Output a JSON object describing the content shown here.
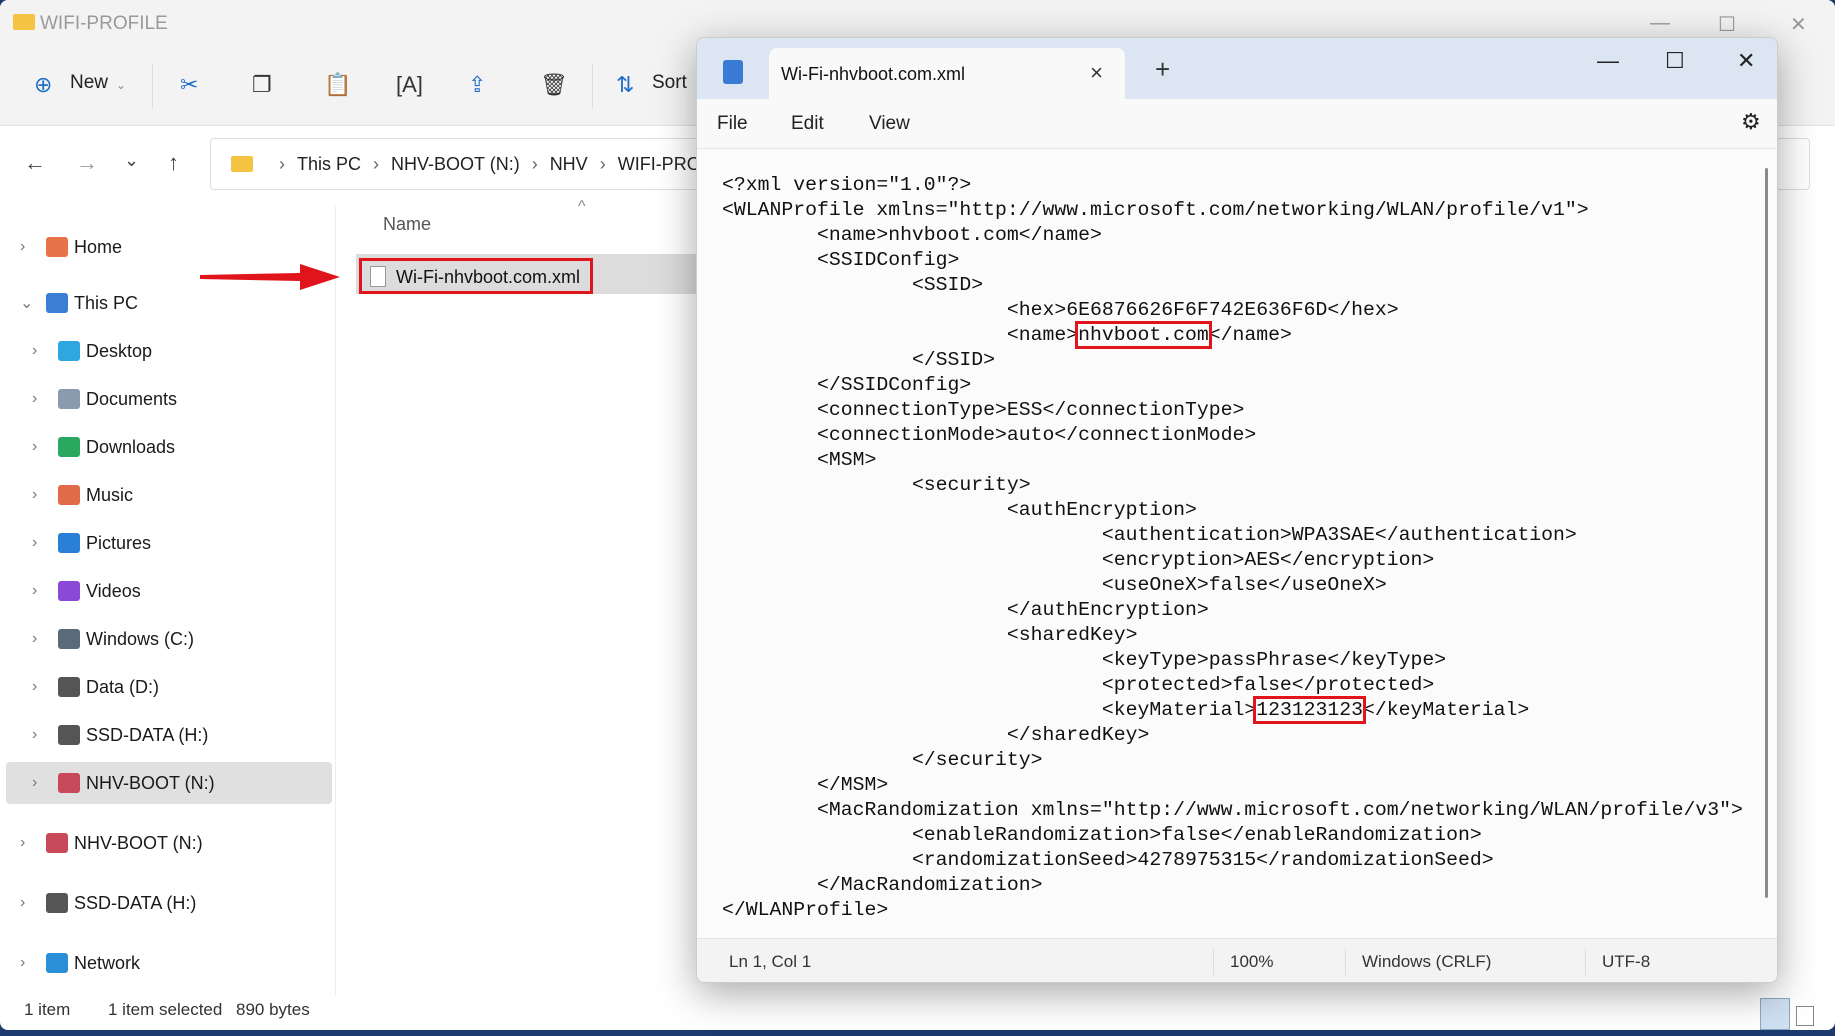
{
  "explorer": {
    "title": "WIFI-PROFILE",
    "toolbar": {
      "new_label": "New",
      "sort_label": "Sort",
      "icons": [
        "cut-icon",
        "copy-icon",
        "paste-icon",
        "rename-icon",
        "share-icon",
        "delete-icon"
      ]
    },
    "breadcrumb": [
      "This PC",
      "NHV-BOOT (N:)",
      "NHV",
      "WIFI-PROFILE"
    ],
    "sidebar": [
      {
        "label": "Home",
        "icon": "home-icon",
        "color": "#e8734a"
      },
      {
        "label": "This PC",
        "icon": "computer-icon",
        "color": "#3b7fd4"
      },
      {
        "label": "Desktop",
        "icon": "desktop-icon",
        "color": "#2ea6e0"
      },
      {
        "label": "Documents",
        "icon": "documents-icon",
        "color": "#8a9bb0"
      },
      {
        "label": "Downloads",
        "icon": "downloads-icon",
        "color": "#2aa860"
      },
      {
        "label": "Music",
        "icon": "music-icon",
        "color": "#e06a4a"
      },
      {
        "label": "Pictures",
        "icon": "pictures-icon",
        "color": "#2a7fd6"
      },
      {
        "label": "Videos",
        "icon": "videos-icon",
        "color": "#8a4ad6"
      },
      {
        "label": "Windows (C:)",
        "icon": "drive-icon",
        "color": "#5a6a7a"
      },
      {
        "label": "Data (D:)",
        "icon": "drive-icon",
        "color": "#555"
      },
      {
        "label": "SSD-DATA (H:)",
        "icon": "drive-icon",
        "color": "#555"
      },
      {
        "label": "NHV-BOOT (N:)",
        "icon": "usb-drive-icon",
        "color": "#c84a5a"
      },
      {
        "label": "NHV-BOOT (N:)",
        "icon": "usb-drive-icon",
        "color": "#c84a5a"
      },
      {
        "label": "SSD-DATA (H:)",
        "icon": "drive-icon",
        "color": "#555"
      },
      {
        "label": "Network",
        "icon": "network-icon",
        "color": "#2a8fd6"
      }
    ],
    "column_name": "Name",
    "file": "Wi-Fi-nhvboot.com.xml",
    "status": {
      "count": "1 item",
      "selected": "1 item selected",
      "size": "890 bytes"
    }
  },
  "notepad": {
    "tab_title": "Wi-Fi-nhvboot.com.xml",
    "menu": [
      "File",
      "Edit",
      "View"
    ],
    "lines": [
      [
        {
          "t": "<?xml version=\"1.0\"?>"
        }
      ],
      [
        {
          "t": "<WLANProfile xmlns=\"http://www.microsoft.com/networking/WLAN/profile/v1\">"
        }
      ],
      [
        {
          "t": "\t<name>nhvboot.com</name>"
        }
      ],
      [
        {
          "t": "\t<SSIDConfig>"
        }
      ],
      [
        {
          "t": "\t\t<SSID>"
        }
      ],
      [
        {
          "t": "\t\t\t<hex>6E6876626F6F742E636F6D</hex>"
        }
      ],
      [
        {
          "t": "\t\t\t<name>"
        },
        {
          "t": "nhvboot.com",
          "hl": true
        },
        {
          "t": "</name>"
        }
      ],
      [
        {
          "t": "\t\t</SSID>"
        }
      ],
      [
        {
          "t": "\t</SSIDConfig>"
        }
      ],
      [
        {
          "t": "\t<connectionType>ESS</connectionType>"
        }
      ],
      [
        {
          "t": "\t<connectionMode>auto</connectionMode>"
        }
      ],
      [
        {
          "t": "\t<MSM>"
        }
      ],
      [
        {
          "t": "\t\t<security>"
        }
      ],
      [
        {
          "t": "\t\t\t<authEncryption>"
        }
      ],
      [
        {
          "t": "\t\t\t\t<authentication>WPA3SAE</authentication>"
        }
      ],
      [
        {
          "t": "\t\t\t\t<encryption>AES</encryption>"
        }
      ],
      [
        {
          "t": "\t\t\t\t<useOneX>false</useOneX>"
        }
      ],
      [
        {
          "t": "\t\t\t</authEncryption>"
        }
      ],
      [
        {
          "t": "\t\t\t<sharedKey>"
        }
      ],
      [
        {
          "t": "\t\t\t\t<keyType>passPhrase</keyType>"
        }
      ],
      [
        {
          "t": "\t\t\t\t<protected>false</protected>"
        }
      ],
      [
        {
          "t": "\t\t\t\t<keyMaterial>"
        },
        {
          "t": "123123123",
          "hl": true
        },
        {
          "t": "</keyMaterial>"
        }
      ],
      [
        {
          "t": "\t\t\t</sharedKey>"
        }
      ],
      [
        {
          "t": "\t\t</security>"
        }
      ],
      [
        {
          "t": "\t</MSM>"
        }
      ],
      [
        {
          "t": "\t<MacRandomization xmlns=\"http://www.microsoft.com/networking/WLAN/profile/v3\">"
        }
      ],
      [
        {
          "t": "\t\t<enableRandomization>false</enableRandomization>"
        }
      ],
      [
        {
          "t": "\t\t<randomizationSeed>4278975315</randomizationSeed>"
        }
      ],
      [
        {
          "t": "\t</MacRandomization>"
        }
      ],
      [
        {
          "t": "</WLANProfile>"
        }
      ]
    ],
    "status": {
      "position": "Ln 1, Col 1",
      "zoom": "100%",
      "line_ending": "Windows (CRLF)",
      "encoding": "UTF-8"
    }
  },
  "highlight_color": "#e0141b"
}
